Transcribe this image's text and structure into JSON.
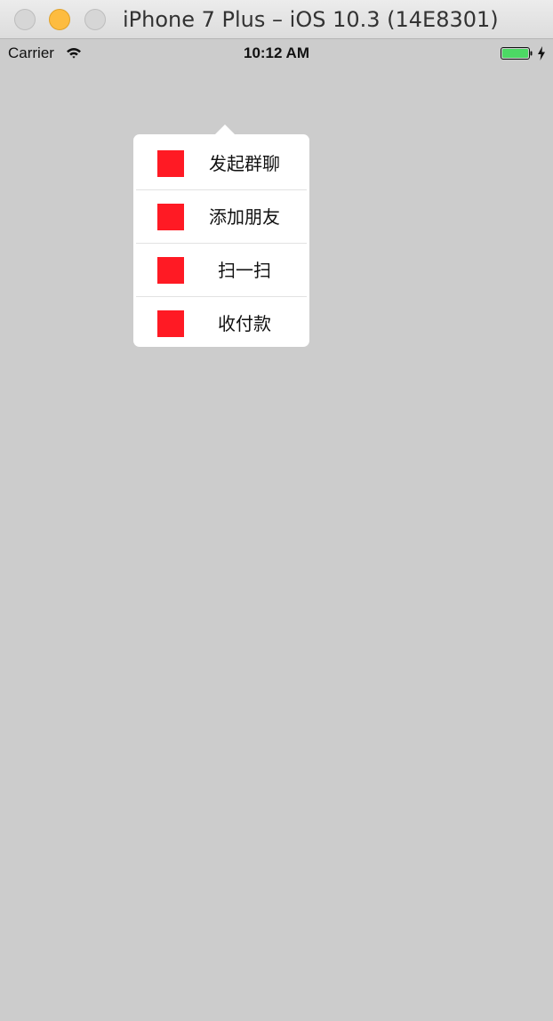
{
  "window": {
    "title": "iPhone 7 Plus – iOS 10.3 (14E8301)",
    "traffic_light_colors": {
      "close": "#d6d6d6",
      "minimize": "#fdbc40",
      "zoom": "#d6d6d6"
    }
  },
  "status_bar": {
    "carrier": "Carrier",
    "time": "10:12 AM",
    "icons": [
      "wifi-icon",
      "battery-icon",
      "charging-bolt-icon"
    ],
    "battery_color": "#4cd964"
  },
  "popover_menu": {
    "icon_color": "#ff1a24",
    "items": [
      {
        "label": "发起群聊",
        "icon": "red-square-icon"
      },
      {
        "label": "添加朋友",
        "icon": "red-square-icon"
      },
      {
        "label": "扫一扫",
        "icon": "red-square-icon"
      },
      {
        "label": "收付款",
        "icon": "red-square-icon"
      }
    ]
  },
  "background_color": "#cccccc"
}
